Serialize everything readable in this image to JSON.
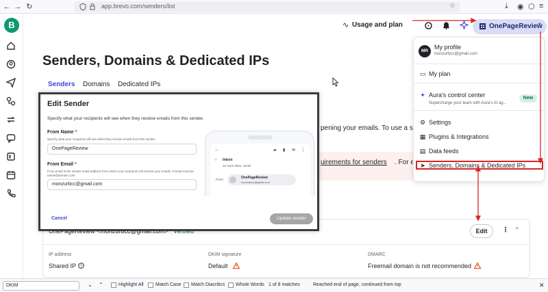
{
  "browser": {
    "url": "app.brevo.com/senders/list"
  },
  "topbar": {
    "usage_label": "Usage and plan",
    "account_label": "OnePageReview"
  },
  "page": {
    "title": "Senders, Domains & Dedicated IPs",
    "tabs": [
      "Senders",
      "Domains",
      "Dedicated IPs"
    ],
    "bg_text_1": "pening your emails. To use a sende",
    "bg_text_2": "uirements for senders",
    "bg_text_2b": ". For each se"
  },
  "sender_card": {
    "header": "OnePageReview <monzurbcc@gmail.com>",
    "verified": "Verified",
    "edit_label": "Edit",
    "columns": [
      {
        "label": "IP address",
        "value": "Shared IP"
      },
      {
        "label": "DKIM signature",
        "value": "Default"
      },
      {
        "label": "DMARC",
        "value": "Freemail domain is not recommended"
      }
    ]
  },
  "modal": {
    "title": "Edit Sender",
    "subtitle": "Specify what your recipients will see when they receive emails from this sender.",
    "from_name": {
      "label": "From Name",
      "required": "*",
      "help": "Specify what your recipients will see when they receive emails from this sender.",
      "value": "OnePageReview"
    },
    "from_email": {
      "label": "From Email",
      "required": "*",
      "help": "From email is the sender email address from which your recipients will receive your emails. Format must be name@domain.com.",
      "value": "monzurbcc@gmail.com"
    },
    "cancel_label": "Cancel",
    "update_label": "Update sender",
    "preview": {
      "inbox": "Inbox",
      "date": "10 June 2021, 19:45",
      "from_label": "From:",
      "sender_name": "OnePageReview",
      "sender_email": "monzurbcc@gmail.com"
    }
  },
  "dropdown": {
    "profile": {
      "initials": "MR",
      "title": "My profile",
      "email": "monzurbcc@gmail.com"
    },
    "items": [
      {
        "label": "My plan",
        "icon": "plan-icon"
      },
      {
        "label": "Aura's control center",
        "icon": "aura-icon",
        "sub": "Supercharge your team with Aura's AI ag...",
        "badge": "New"
      },
      {
        "label": "Settings",
        "icon": "gear-icon"
      },
      {
        "label": "Plugins & Integrations",
        "icon": "plugin-icon"
      },
      {
        "label": "Data feeds",
        "icon": "data-feed-icon"
      },
      {
        "label": "Senders, Domains & Dedicated IPs",
        "icon": "send-icon"
      }
    ]
  },
  "findbar": {
    "query": "DKIM",
    "highlight_all": "Highlight All",
    "match_case": "Match Case",
    "match_diacritics": "Match Diacritics",
    "whole_words": "Whole Words",
    "status": "1 of 8 matches",
    "message": "Reached end of page, continued from top"
  },
  "colors": {
    "accent": "#3b49d6",
    "brand": "#0b996e",
    "annotation": "#d92424",
    "warning": "#e8590c"
  }
}
